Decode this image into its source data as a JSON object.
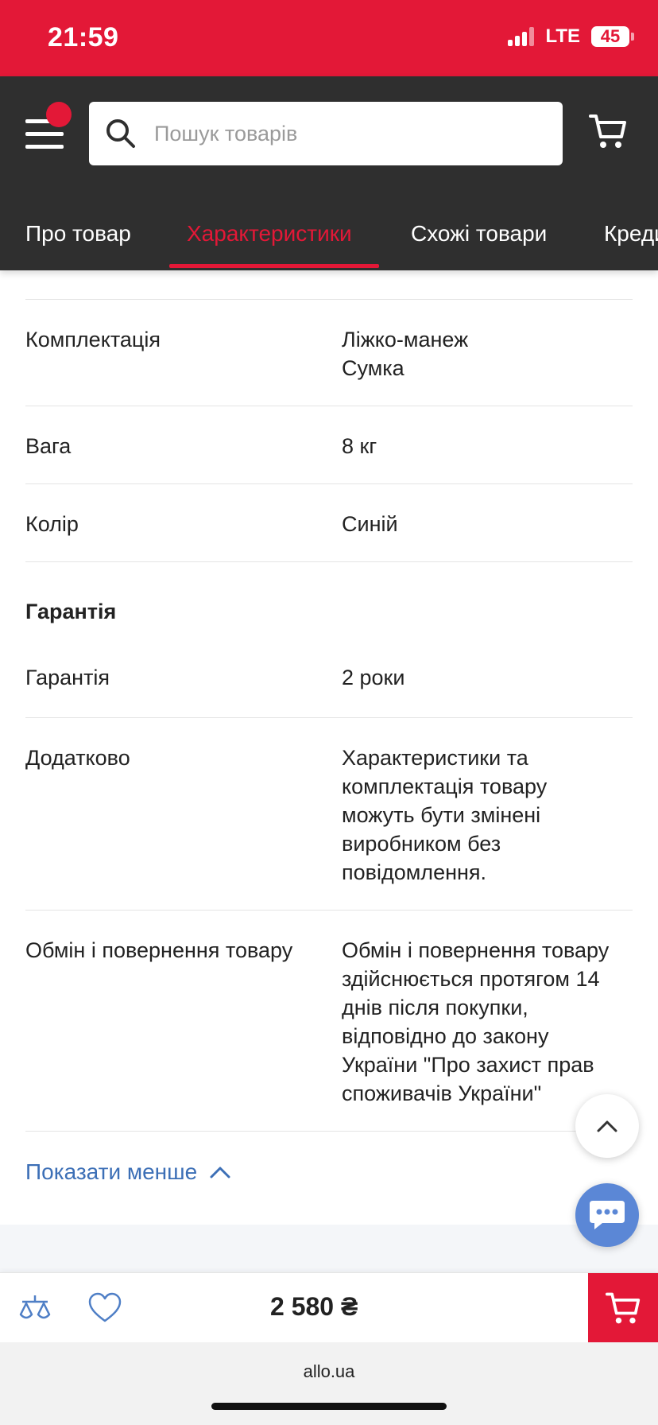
{
  "status_bar": {
    "time": "21:59",
    "network": "LTE",
    "battery": "45"
  },
  "header": {
    "search_placeholder": "Пошук товарів",
    "tabs": [
      {
        "label": "Про товар",
        "active": false
      },
      {
        "label": "Характеристики",
        "active": true
      },
      {
        "label": "Схожі товари",
        "active": false
      },
      {
        "label": "Кредит",
        "active": false
      }
    ]
  },
  "specs": {
    "rows": [
      {
        "key": "Комплектація",
        "value_lines": [
          "Ліжко-манеж",
          "Сумка"
        ]
      },
      {
        "key": "Вага",
        "value": "8 кг"
      },
      {
        "key": "Колір",
        "value": "Синій"
      }
    ],
    "group_warranty": "Гарантія",
    "warranty_rows": [
      {
        "key": "Гарантія",
        "value": "2 роки"
      },
      {
        "key": "Додатково",
        "value_lines": [
          "Характеристики та",
          "комплектація товару",
          "можуть бути змінені",
          "виробником без",
          "повідомлення."
        ]
      },
      {
        "key": "Обмін і повернення товару",
        "value_lines": [
          "Обмін і повернення товару",
          "здійснюється протягом 14",
          "днів після покупки,",
          "відповідно до закону",
          "України \"Про захист прав",
          "споживачів України\""
        ]
      }
    ],
    "show_less": "Показати менше"
  },
  "bottom_bar": {
    "price": "2 580 ₴"
  },
  "browser": {
    "url": "allo.ua"
  },
  "colors": {
    "brand_red": "#e31837",
    "header_dark": "#2f2f2f",
    "link_blue": "#3c6fb6",
    "chat_blue": "#5b87d6"
  }
}
